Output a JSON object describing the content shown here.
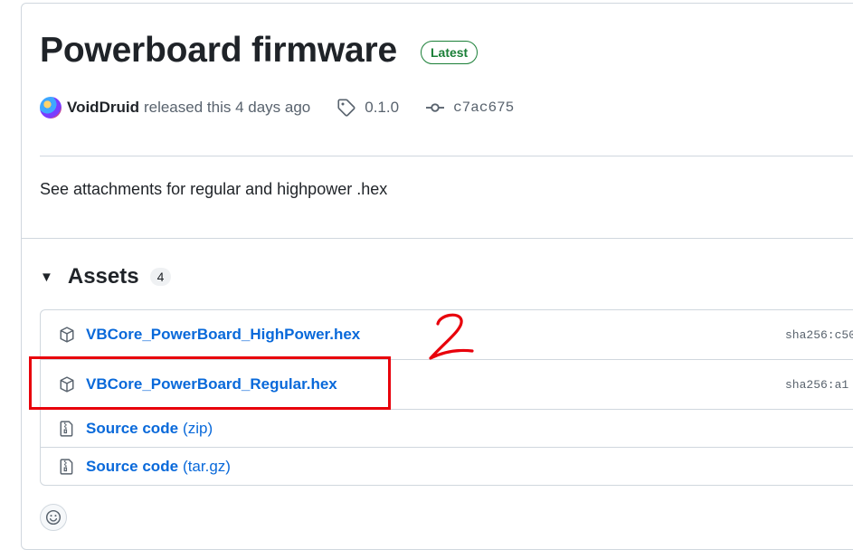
{
  "release": {
    "title": "Powerboard firmware",
    "badge": "Latest",
    "author": "VoidDruid",
    "released_text": "released this 4 days ago",
    "tag": "0.1.0",
    "commit": "c7ac675",
    "description": "See attachments for regular and highpower .hex"
  },
  "assets": {
    "heading": "Assets",
    "count": "4",
    "items": [
      {
        "name": "VBCore_PowerBoard_HighPower.hex",
        "sha": "sha256:c50",
        "icon": "package-icon"
      },
      {
        "name": "VBCore_PowerBoard_Regular.hex",
        "sha": "sha256:a1",
        "icon": "package-icon"
      },
      {
        "name": "Source code",
        "ext": "(zip)",
        "icon": "file-zip-icon"
      },
      {
        "name": "Source code",
        "ext": "(tar.gz)",
        "icon": "file-zip-icon"
      }
    ]
  },
  "annotation": {
    "label": "2",
    "color": "#e8000b"
  },
  "colors": {
    "link": "#0969da",
    "badge_green": "#1a7f37",
    "border": "#d0d7de"
  }
}
